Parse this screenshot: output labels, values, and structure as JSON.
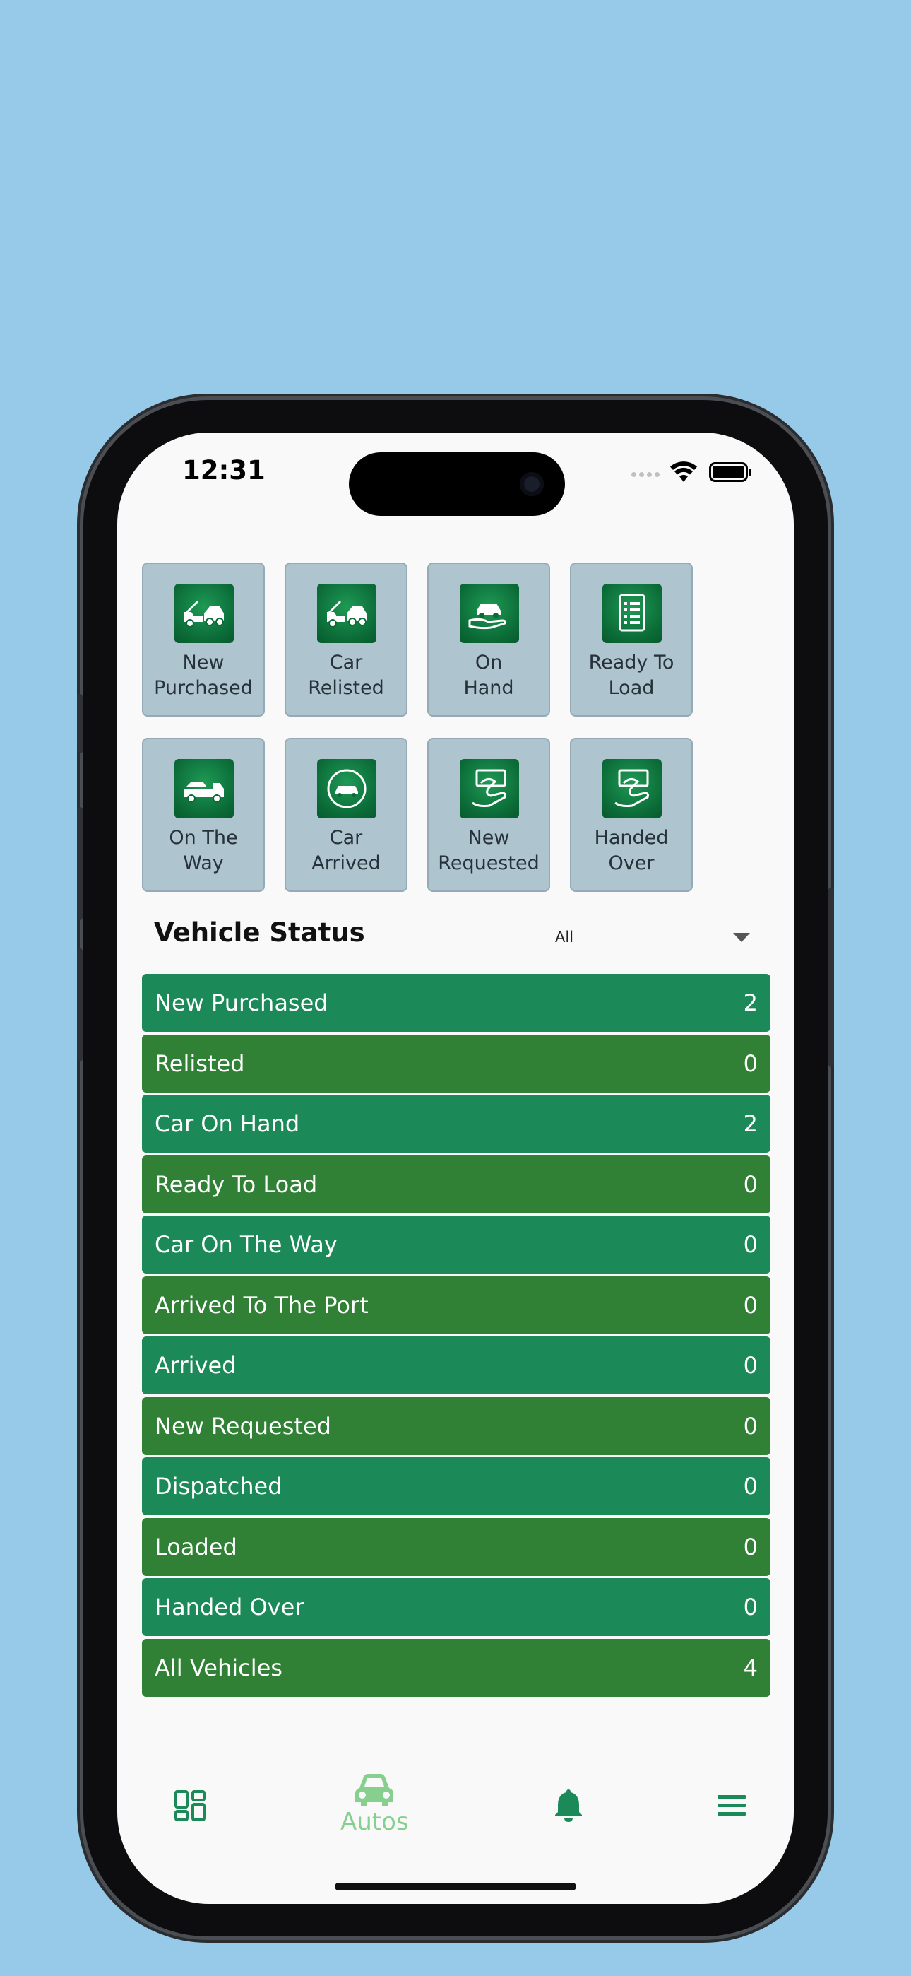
{
  "status_bar": {
    "time": "12:31"
  },
  "tiles": [
    {
      "label": "New\nPurchased",
      "icon": "tow-truck-icon"
    },
    {
      "label": "Car\nRelisted",
      "icon": "tow-truck-icon"
    },
    {
      "label": "On\nHand",
      "icon": "car-in-hand-icon"
    },
    {
      "label": "Ready To\nLoad",
      "icon": "checklist-icon"
    },
    {
      "label": "On The\nWay",
      "icon": "flatbed-truck-icon"
    },
    {
      "label": "Car\nArrived",
      "icon": "car-arrived-badge-icon"
    },
    {
      "label": "New\nRequested",
      "icon": "hand-request-icon"
    },
    {
      "label": "Handed\nOver",
      "icon": "hand-over-icon"
    }
  ],
  "vehicle_status": {
    "title": "Vehicle Status",
    "filter_value": "All",
    "rows": [
      {
        "label": "New Purchased",
        "count": "2"
      },
      {
        "label": "Relisted",
        "count": "0"
      },
      {
        "label": "Car On Hand",
        "count": "2"
      },
      {
        "label": "Ready To Load",
        "count": "0"
      },
      {
        "label": "Car On The Way",
        "count": "0"
      },
      {
        "label": "Arrived To The Port",
        "count": "0"
      },
      {
        "label": "Arrived",
        "count": "0"
      },
      {
        "label": "New Requested",
        "count": "0"
      },
      {
        "label": "Dispatched",
        "count": "0"
      },
      {
        "label": "Loaded",
        "count": "0"
      },
      {
        "label": "Handed Over",
        "count": "0"
      },
      {
        "label": "All Vehicles",
        "count": "4"
      }
    ]
  },
  "tabbar": {
    "items": [
      {
        "icon": "dashboard-icon",
        "label": ""
      },
      {
        "icon": "car-icon",
        "label": "Autos"
      },
      {
        "icon": "bell-icon",
        "label": ""
      },
      {
        "icon": "menu-icon",
        "label": ""
      }
    ]
  },
  "colors": {
    "background": "#97c9e8",
    "row_a": "#1b8a58",
    "row_b": "#308135",
    "tile_bg": "#aec4cf",
    "accent_active": "#87cf8f",
    "icon_green": "#1b8a58"
  }
}
